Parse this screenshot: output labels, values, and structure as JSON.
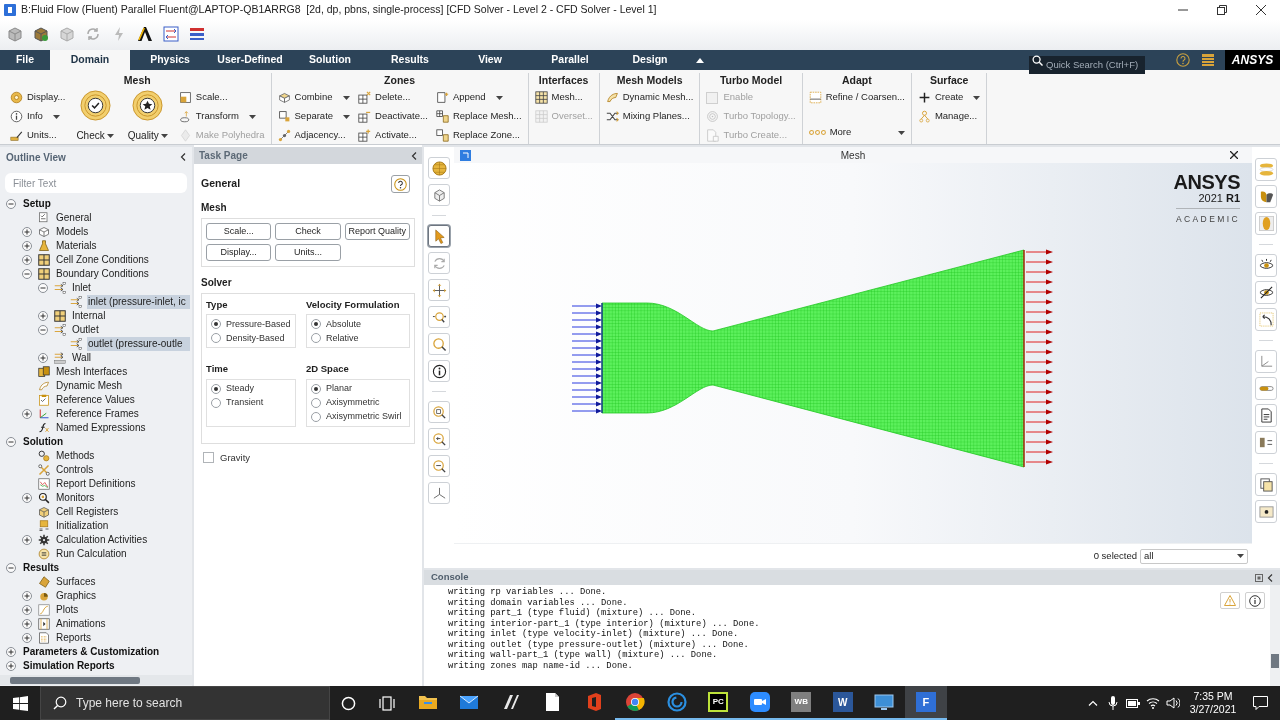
{
  "window": {
    "title": "B:Fluid Flow (Fluent) Parallel Fluent@LAPTOP-QB1ARRG8  [2d, dp, pbns, single-process] [CFD Solver - Level 2 - CFD Solver - Level 1]"
  },
  "ribbon": {
    "tabs": [
      {
        "label": "File",
        "selected": false
      },
      {
        "label": "Domain",
        "selected": true
      },
      {
        "label": "Physics",
        "selected": false
      },
      {
        "label": "User-Defined",
        "selected": false
      },
      {
        "label": "Solution",
        "selected": false
      },
      {
        "label": "Results",
        "selected": false
      },
      {
        "label": "View",
        "selected": false
      },
      {
        "label": "Parallel",
        "selected": false
      },
      {
        "label": "Design",
        "selected": false
      }
    ],
    "search": {
      "placeholder": "Quick Search (Ctrl+F)"
    },
    "logo": "ANSYS",
    "groups": [
      {
        "title": "Mesh",
        "columns": [
          [
            {
              "label": "Display...",
              "kind": "small",
              "dropdown": false,
              "disabled": false
            },
            {
              "label": "Info",
              "kind": "small",
              "dropdown": true,
              "disabled": false
            },
            {
              "label": "Units...",
              "kind": "small",
              "dropdown": false,
              "disabled": false
            }
          ],
          [
            {
              "label": "Check",
              "kind": "large",
              "dropdown": true,
              "disabled": false
            }
          ],
          [
            {
              "label": "Quality",
              "kind": "large",
              "dropdown": true,
              "disabled": false
            }
          ],
          [
            {
              "label": "Scale...",
              "kind": "small",
              "dropdown": false,
              "disabled": false
            },
            {
              "label": "Transform",
              "kind": "small",
              "dropdown": true,
              "disabled": false
            },
            {
              "label": "Make Polyhedra",
              "kind": "small",
              "dropdown": false,
              "disabled": true
            }
          ]
        ]
      },
      {
        "title": "Zones",
        "columns": [
          [
            {
              "label": "Combine",
              "kind": "small",
              "dropdown": true,
              "disabled": false
            },
            {
              "label": "Separate",
              "kind": "small",
              "dropdown": true,
              "disabled": false
            },
            {
              "label": "Adjacency...",
              "kind": "small",
              "dropdown": false,
              "disabled": false
            }
          ],
          [
            {
              "label": "Delete...",
              "kind": "small",
              "dropdown": false,
              "disabled": false
            },
            {
              "label": "Deactivate...",
              "kind": "small",
              "dropdown": false,
              "disabled": false
            },
            {
              "label": "Activate...",
              "kind": "small",
              "dropdown": false,
              "disabled": false
            }
          ],
          [
            {
              "label": "Append",
              "kind": "small",
              "dropdown": true,
              "disabled": false
            },
            {
              "label": "Replace Mesh...",
              "kind": "small",
              "dropdown": false,
              "disabled": false
            },
            {
              "label": "Replace Zone...",
              "kind": "small",
              "dropdown": false,
              "disabled": false
            }
          ]
        ]
      },
      {
        "title": "Interfaces",
        "columns": [
          [
            {
              "label": "Mesh...",
              "kind": "small",
              "dropdown": false,
              "disabled": false
            },
            {
              "label": "Overset...",
              "kind": "small",
              "dropdown": false,
              "disabled": true
            }
          ]
        ]
      },
      {
        "title": "Mesh Models",
        "columns": [
          [
            {
              "label": "Dynamic Mesh...",
              "kind": "small",
              "dropdown": false,
              "disabled": false
            },
            {
              "label": "Mixing Planes...",
              "kind": "small",
              "dropdown": false,
              "disabled": false
            }
          ]
        ]
      },
      {
        "title": "Turbo Model",
        "columns": [
          [
            {
              "label": "Enable",
              "kind": "checkbox",
              "checked": false,
              "disabled": true
            },
            {
              "label": "Turbo Topology...",
              "kind": "small",
              "dropdown": false,
              "disabled": true
            },
            {
              "label": "Turbo Create...",
              "kind": "small",
              "dropdown": false,
              "disabled": true
            }
          ]
        ]
      },
      {
        "title": "Adapt",
        "columns": [
          [
            {
              "label": "Refine / Coarsen...",
              "kind": "small",
              "dropdown": false,
              "disabled": false
            },
            {
              "label": "More",
              "kind": "more",
              "dropdown": true,
              "disabled": false
            }
          ]
        ]
      },
      {
        "title": "Surface",
        "columns": [
          [
            {
              "label": "Create",
              "kind": "small",
              "dropdown": true,
              "disabled": false
            },
            {
              "label": "Manage...",
              "kind": "small",
              "dropdown": false,
              "disabled": false
            }
          ]
        ]
      }
    ]
  },
  "outline": {
    "title": "Outline View",
    "filter": {
      "placeholder": "Filter Text"
    },
    "tree": [
      {
        "label": "Setup",
        "expanded": true,
        "selected": false,
        "children": [
          {
            "label": "General",
            "selected": false
          },
          {
            "label": "Models",
            "expanded": false,
            "selected": false
          },
          {
            "label": "Materials",
            "expanded": false,
            "selected": false
          },
          {
            "label": "Cell Zone Conditions",
            "expanded": false,
            "selected": false
          },
          {
            "label": "Boundary Conditions",
            "expanded": true,
            "selected": false,
            "children": [
              {
                "label": "Inlet",
                "expanded": true,
                "selected": false,
                "children": [
                  {
                    "label": "inlet (pressure-inlet, ic",
                    "selected": true
                  }
                ]
              },
              {
                "label": "Internal",
                "expanded": false,
                "selected": false
              },
              {
                "label": "Outlet",
                "expanded": true,
                "selected": false,
                "children": [
                  {
                    "label": "outlet (pressure-outle",
                    "selected": true
                  }
                ]
              },
              {
                "label": "Wall",
                "expanded": false,
                "selected": false
              }
            ]
          },
          {
            "label": "Mesh Interfaces",
            "selected": false
          },
          {
            "label": "Dynamic Mesh",
            "selected": false
          },
          {
            "label": "Reference Values",
            "selected": false
          },
          {
            "label": "Reference Frames",
            "expanded": false,
            "selected": false
          },
          {
            "label": "Named Expressions",
            "selected": false
          }
        ]
      },
      {
        "label": "Solution",
        "expanded": true,
        "selected": false,
        "children": [
          {
            "label": "Methods",
            "selected": false
          },
          {
            "label": "Controls",
            "selected": false
          },
          {
            "label": "Report Definitions",
            "selected": false
          },
          {
            "label": "Monitors",
            "expanded": false,
            "selected": false
          },
          {
            "label": "Cell Registers",
            "selected": false
          },
          {
            "label": "Initialization",
            "selected": false
          },
          {
            "label": "Calculation Activities",
            "expanded": false,
            "selected": false
          },
          {
            "label": "Run Calculation",
            "selected": false
          }
        ]
      },
      {
        "label": "Results",
        "expanded": true,
        "selected": false,
        "children": [
          {
            "label": "Surfaces",
            "selected": false
          },
          {
            "label": "Graphics",
            "expanded": false,
            "selected": false
          },
          {
            "label": "Plots",
            "expanded": false,
            "selected": false
          },
          {
            "label": "Animations",
            "expanded": false,
            "selected": false
          },
          {
            "label": "Reports",
            "expanded": false,
            "selected": false
          }
        ]
      },
      {
        "label": "Parameters & Customization",
        "expanded": false,
        "selected": false
      },
      {
        "label": "Simulation Reports",
        "expanded": false,
        "selected": false
      }
    ]
  },
  "task_page": {
    "title": "Task Page",
    "heading": "General",
    "mesh": {
      "title": "Mesh",
      "buttons": [
        "Scale...",
        "Check",
        "Report Quality",
        "Display...",
        "Units..."
      ]
    },
    "solver": {
      "title": "Solver",
      "groups": [
        {
          "title": "Type",
          "options": [
            {
              "label": "Pressure-Based",
              "selected": true
            },
            {
              "label": "Density-Based",
              "selected": false
            }
          ]
        },
        {
          "title": "Velocity Formulation",
          "options": [
            {
              "label": "Absolute",
              "selected": true
            },
            {
              "label": "Relative",
              "selected": false
            }
          ]
        },
        {
          "title": "Time",
          "options": [
            {
              "label": "Steady",
              "selected": true
            },
            {
              "label": "Transient",
              "selected": false
            }
          ]
        },
        {
          "title": "2D Space",
          "options": [
            {
              "label": "Planar",
              "selected": true
            },
            {
              "label": "Axisymmetric",
              "selected": false
            },
            {
              "label": "Axisymmetric Swirl",
              "selected": false
            }
          ]
        }
      ]
    },
    "gravity": {
      "label": "Gravity",
      "checked": false
    }
  },
  "graphics": {
    "toolbar": [
      {
        "selected": false
      },
      {
        "selected": false
      },
      {
        "selected": true
      },
      {
        "selected": false
      },
      {
        "selected": false
      },
      {
        "selected": false
      },
      {
        "selected": false
      },
      {
        "selected": false
      },
      {
        "selected": false
      },
      {
        "selected": false
      },
      {
        "selected": false
      },
      {
        "selected": false
      }
    ],
    "title": "Mesh",
    "logo": {
      "brand": "ANSYS",
      "version": "2021 **R1**",
      "edition": "ACADEMIC"
    },
    "selection": {
      "count": "0 selected",
      "filter": "all"
    }
  },
  "console": {
    "title": "Console",
    "lines": [
      "writing rp variables ... Done.",
      "writing domain variables ... Done.",
      "writing part_1 (type fluid) (mixture) ... Done.",
      "writing interior-part_1 (type interior) (mixture) ... Done.",
      "writing inlet (type velocity-inlet) (mixture) ... Done.",
      "writing outlet (type pressure-outlet) (mixture) ... Done.",
      "writing wall-part_1 (type wall) (mixture) ... Done.",
      "writing zones map name-id ... Done."
    ]
  },
  "taskbar": {
    "search": {
      "placeholder": "Type here to search"
    },
    "apps": [
      {
        "open": false,
        "selected": false
      },
      {
        "open": false,
        "selected": false
      },
      {
        "open": false,
        "selected": false
      },
      {
        "open": false,
        "selected": false
      },
      {
        "open": false,
        "selected": false
      },
      {
        "open": true,
        "selected": false
      },
      {
        "open": true,
        "selected": false
      },
      {
        "open": true,
        "selected": false,
        "glyph": "PC"
      },
      {
        "open": true,
        "selected": false
      },
      {
        "open": true,
        "selected": false,
        "glyph": "WB"
      },
      {
        "open": true,
        "selected": false,
        "glyph": "W"
      },
      {
        "open": true,
        "selected": false
      },
      {
        "open": true,
        "selected": true,
        "glyph": "F"
      }
    ],
    "time": "7:35 PM",
    "date": "3/27/2021"
  }
}
